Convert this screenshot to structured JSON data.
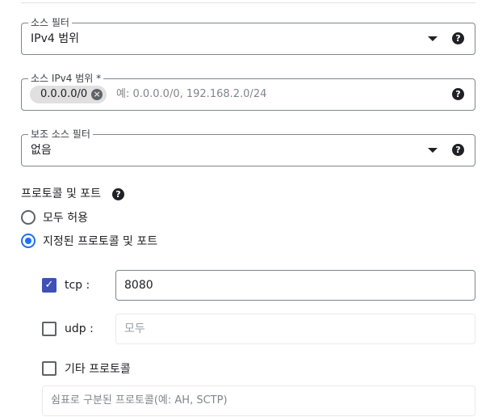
{
  "source_filter": {
    "label": "소스 필터",
    "value": "IPv4 범위"
  },
  "source_ipv4_ranges": {
    "label": "소스 IPv4 범위 *",
    "chip": "0.0.0.0/0",
    "chip_close": "×",
    "placeholder": "예: 0.0.0.0/0, 192.168.2.0/24"
  },
  "secondary_source_filter": {
    "label": "보조 소스 필터",
    "value": "없음"
  },
  "help_glyph": "?",
  "protocols_and_ports": {
    "title": "프로토콜 및 포트",
    "options": [
      {
        "label": "모두 허용",
        "selected": false
      },
      {
        "label": "지정된 프로토콜 및 포트",
        "selected": true
      }
    ],
    "tcp": {
      "label": "tcp :",
      "checked": true,
      "value": "8080"
    },
    "udp": {
      "label": "udp :",
      "checked": false,
      "value": "모두"
    },
    "other": {
      "label": "기타 프로토콜",
      "checked": false,
      "placeholder": "쉼표로 구분된 프로토콜(예: AH, SCTP)"
    },
    "check_glyph": "✓"
  },
  "colors": {
    "accent": "#1a73e8",
    "checkbox": "#3f51b5",
    "border": "#80868b"
  }
}
